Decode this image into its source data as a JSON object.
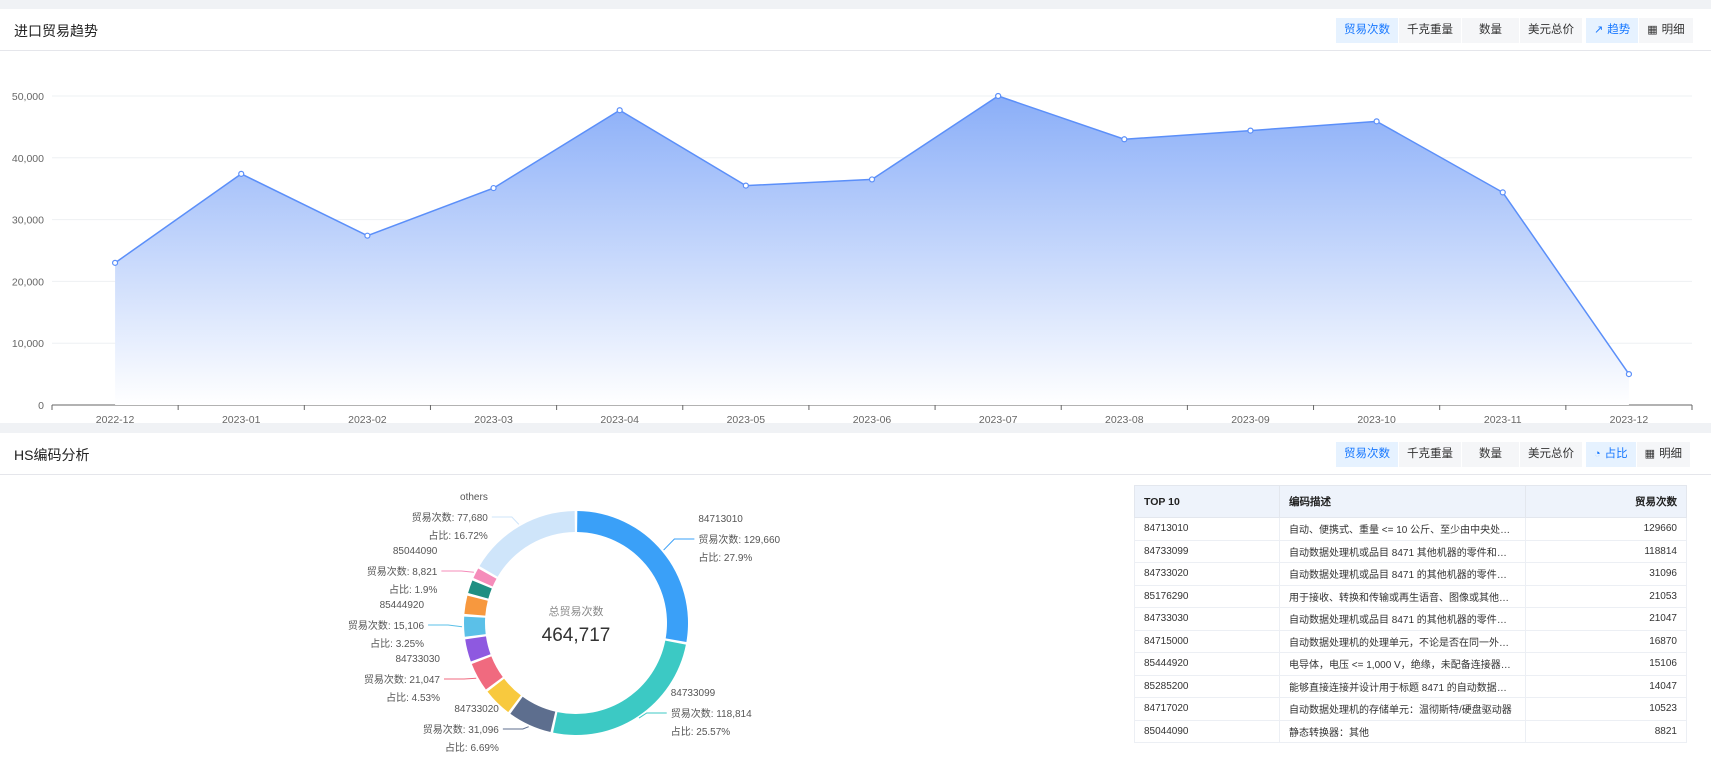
{
  "trend": {
    "title": "进口贸易趋势",
    "metric_buttons": [
      "贸易次数",
      "千克重量",
      "数量",
      "美元总价"
    ],
    "active_metric": 0,
    "view_buttons": [
      {
        "label": "趋势",
        "icon": "line-chart-icon"
      },
      {
        "label": "明细",
        "icon": "table-icon"
      }
    ],
    "active_view": 0
  },
  "hs": {
    "title": "HS编码分析",
    "metric_buttons": [
      "贸易次数",
      "千克重量",
      "数量",
      "美元总价"
    ],
    "active_metric": 0,
    "view_buttons": [
      {
        "label": "占比",
        "icon": "pie-chart-icon"
      },
      {
        "label": "明细",
        "icon": "table-icon"
      }
    ],
    "active_view": 0,
    "table": {
      "headers": [
        "TOP 10",
        "编码描述",
        "贸易次数"
      ],
      "rows": [
        [
          "84713010",
          "自动、便携式、重量 <= 10 公斤、至少由中央处理器...",
          "129660"
        ],
        [
          "84733099",
          "自动数据处理机或品目 8471 其他机器的零件和配件...",
          "118814"
        ],
        [
          "84733020",
          "自动数据处理机或品目 8471 的其他机器的零件和配...",
          "31096"
        ],
        [
          "85176290",
          "用于接收、转换和传输或再生语音、图像或其他数据...",
          "21053"
        ],
        [
          "84733030",
          "自动数据处理机或品目 8471 的其他机器的零件和附...",
          "21047"
        ],
        [
          "84715000",
          "自动数据处理机的处理单元，不论是否在同一外壳内...",
          "16870"
        ],
        [
          "85444920",
          "电导体，电压 <= 1,000 V，绝缘，未配备连接器，其...",
          "15106"
        ],
        [
          "85285200",
          "能够直接连接并设计用于标题 8471 的自动数据处理...",
          "14047"
        ],
        [
          "84717020",
          "自动数据处理机的存储单元：温彻斯特/硬盘驱动器",
          "10523"
        ],
        [
          "85044090",
          "静态转换器：其他",
          "8821"
        ]
      ]
    }
  },
  "colors": {
    "line": "#5b8ff9",
    "area_top": "#8aaef8",
    "area_bottom": "#ffffff",
    "active_btn_text": "#1677ff",
    "active_btn_bg": "#e6f2ff"
  },
  "chart_data": [
    {
      "type": "area",
      "x": [
        "2022-12",
        "2023-01",
        "2023-02",
        "2023-03",
        "2023-04",
        "2023-05",
        "2023-06",
        "2023-07",
        "2023-08",
        "2023-09",
        "2023-10",
        "2023-11",
        "2023-12"
      ],
      "series": [
        {
          "values": [
            23000,
            37400,
            27400,
            35100,
            47700,
            35500,
            36500,
            50000,
            43000,
            44400,
            45900,
            34400,
            5000
          ]
        }
      ],
      "yticks": [
        "0",
        "10,000",
        "20,000",
        "30,000",
        "40,000",
        "50,000"
      ],
      "ylim": [
        0,
        50000
      ],
      "grid": true,
      "title": "",
      "xlabel": "",
      "ylabel": ""
    },
    {
      "type": "pie",
      "center_label": "总贸易次数",
      "center_value": "464,717",
      "slices": [
        {
          "name": "84713010",
          "value": 129660,
          "color": "#3aa0f8",
          "label": "84713010",
          "count_text": "贸易次数: 129,660",
          "pct_text": "占比: 27.9%"
        },
        {
          "name": "84733099",
          "value": 118814,
          "color": "#3cc9c4",
          "label": "84733099",
          "count_text": "贸易次数: 118,814",
          "pct_text": "占比: 25.57%"
        },
        {
          "name": "84733020",
          "value": 31096,
          "color": "#5d6e8e",
          "label": "84733020",
          "count_text": "贸易次数: 31,096",
          "pct_text": "占比: 6.69%"
        },
        {
          "name": "85176290",
          "value": 21053,
          "color": "#f8c93e",
          "label": "",
          "count_text": "",
          "pct_text": ""
        },
        {
          "name": "84733030",
          "value": 21047,
          "color": "#f06a7f",
          "label": "84733030",
          "count_text": "贸易次数: 21,047",
          "pct_text": "占比: 4.53%"
        },
        {
          "name": "84715000",
          "value": 16870,
          "color": "#8e59e0",
          "label": "",
          "count_text": "",
          "pct_text": ""
        },
        {
          "name": "85444920",
          "value": 15106,
          "color": "#5bc0e8",
          "label": "85444920",
          "count_text": "贸易次数: 15,106",
          "pct_text": "占比: 3.25%"
        },
        {
          "name": "85285200",
          "value": 14047,
          "color": "#f7983e",
          "label": "",
          "count_text": "",
          "pct_text": ""
        },
        {
          "name": "84717020",
          "value": 10523,
          "color": "#1f8f82",
          "label": "",
          "count_text": "",
          "pct_text": ""
        },
        {
          "name": "85044090",
          "value": 8821,
          "color": "#f58cba",
          "label": "85044090",
          "count_text": "贸易次数: 8,821",
          "pct_text": "占比: 1.9%"
        },
        {
          "name": "others",
          "value": 77680,
          "color": "#cfe5fa",
          "label": "others",
          "count_text": "贸易次数: 77,680",
          "pct_text": "占比: 16.72%"
        }
      ]
    }
  ]
}
